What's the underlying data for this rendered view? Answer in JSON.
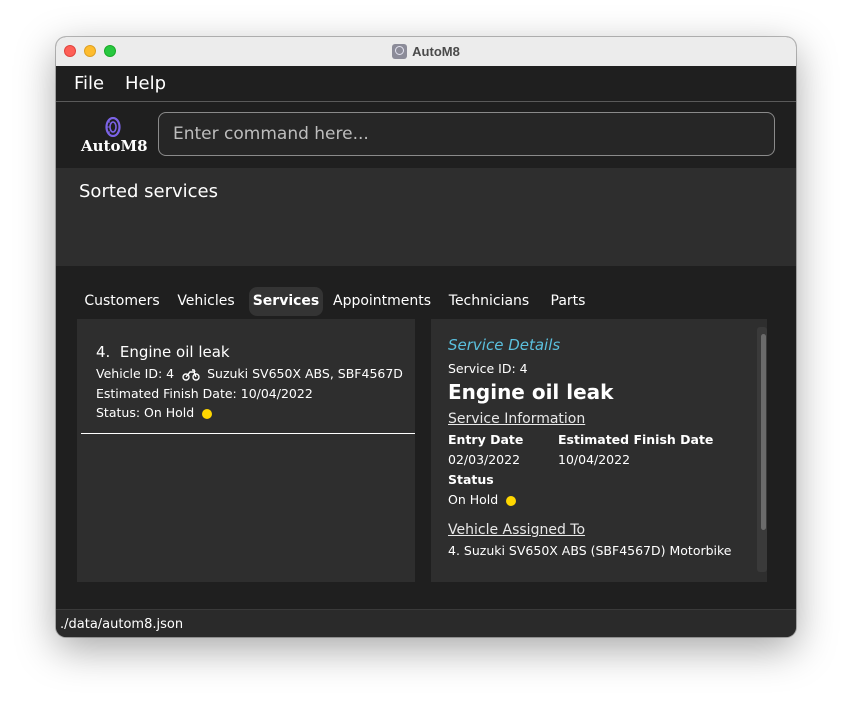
{
  "window": {
    "title": "AutoM8"
  },
  "menu": {
    "file": "File",
    "help": "Help"
  },
  "logo": {
    "text": "AutoM8"
  },
  "command": {
    "placeholder": "Enter command here...",
    "value": ""
  },
  "result": {
    "message": "Sorted services"
  },
  "tabs": [
    {
      "label": "Customers",
      "active": false
    },
    {
      "label": "Vehicles",
      "active": false
    },
    {
      "label": "Services",
      "active": true
    },
    {
      "label": "Appointments",
      "active": false
    },
    {
      "label": "Technicians",
      "active": false
    },
    {
      "label": "Parts",
      "active": false
    }
  ],
  "services": [
    {
      "index": "4.",
      "description": "Engine oil leak",
      "vehicle_prefix": "Vehicle ID: 4",
      "vehicle_icon": "motorbike-icon",
      "vehicle_text": "Suzuki SV650X ABS, SBF4567D",
      "finish": "Estimated Finish Date: 10/04/2022",
      "status": "Status: On Hold",
      "status_color": "#ffd700"
    }
  ],
  "details": {
    "header": "Service Details",
    "service_id": "Service ID: 4",
    "title": "Engine oil leak",
    "info_header": "Service Information",
    "entry_label": "Entry Date",
    "entry_value": "02/03/2022",
    "finish_label": "Estimated Finish Date",
    "finish_value": "10/04/2022",
    "status_label": "Status",
    "status_value": "On Hold",
    "status_color": "#ffd700",
    "vehicle_header": "Vehicle Assigned To",
    "vehicle_value": "4. Suzuki SV650X ABS (SBF4567D) Motorbike"
  },
  "status_bar": {
    "path": "./data/autom8.json"
  },
  "colors": {
    "accent": "#5bc0de",
    "background": "#1f1f1f",
    "panel": "#2e2e2e",
    "status_dot": "#ffd700"
  }
}
